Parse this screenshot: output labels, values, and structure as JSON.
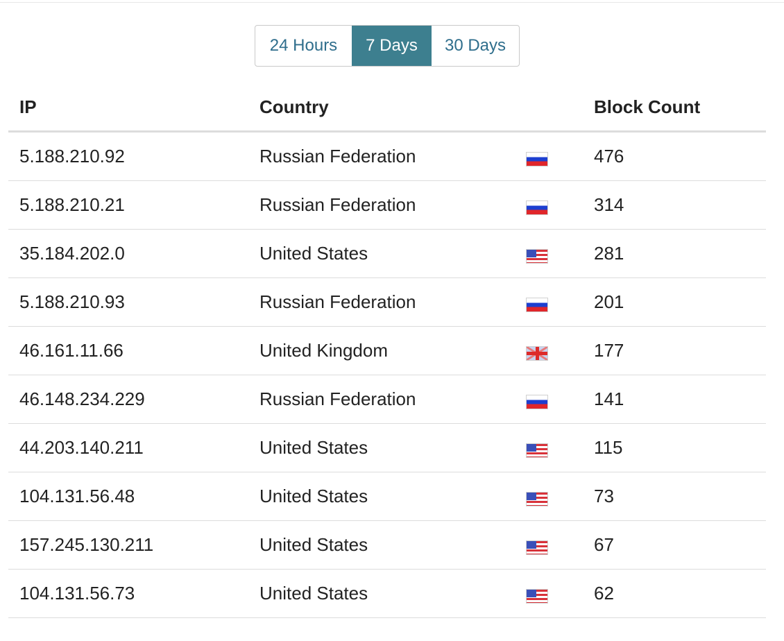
{
  "range_selector": {
    "options": [
      "24 Hours",
      "7 Days",
      "30 Days"
    ],
    "selected": "7 Days"
  },
  "table": {
    "headers": {
      "ip": "IP",
      "country": "Country",
      "block_count": "Block Count"
    },
    "rows": [
      {
        "ip": "5.188.210.92",
        "country": "Russian Federation",
        "flag": "ru-flag-icon",
        "count": "476"
      },
      {
        "ip": "5.188.210.21",
        "country": "Russian Federation",
        "flag": "ru-flag-icon",
        "count": "314"
      },
      {
        "ip": "35.184.202.0",
        "country": "United States",
        "flag": "us-flag-icon",
        "count": "281"
      },
      {
        "ip": "5.188.210.93",
        "country": "Russian Federation",
        "flag": "ru-flag-icon",
        "count": "201"
      },
      {
        "ip": "46.161.11.66",
        "country": "United Kingdom",
        "flag": "gb-flag-icon",
        "count": "177"
      },
      {
        "ip": "46.148.234.229",
        "country": "Russian Federation",
        "flag": "ru-flag-icon",
        "count": "141"
      },
      {
        "ip": "44.203.140.211",
        "country": "United States",
        "flag": "us-flag-icon",
        "count": "115"
      },
      {
        "ip": "104.131.56.48",
        "country": "United States",
        "flag": "us-flag-icon",
        "count": "73"
      },
      {
        "ip": "157.245.130.211",
        "country": "United States",
        "flag": "us-flag-icon",
        "count": "67"
      },
      {
        "ip": "104.131.56.73",
        "country": "United States",
        "flag": "us-flag-icon",
        "count": "62"
      }
    ]
  },
  "colors": {
    "accent": "#3d7f8f",
    "link": "#2f6e8c",
    "divider": "#dcdcdc"
  }
}
